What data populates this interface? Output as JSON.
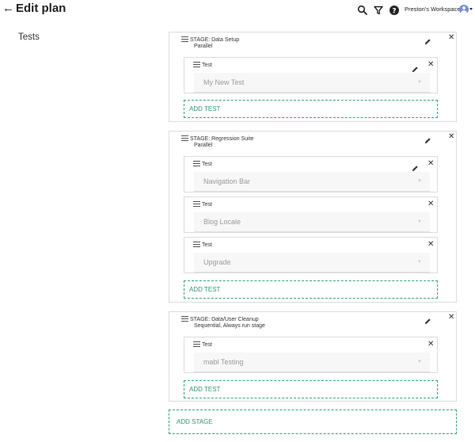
{
  "header": {
    "back_icon": "arrow-left-icon",
    "title": "Edit plan",
    "icons": [
      "search-icon",
      "filter-icon",
      "help-icon"
    ],
    "workspace_label": "Preston's Workspace",
    "avatar_icon": "user-avatar-icon"
  },
  "main": {
    "section_title": "Tests",
    "stages": [
      {
        "title": "STAGE: Data Setup",
        "subtitle": "Parallel",
        "tests": [
          {
            "label": "Test",
            "value": "My New Test",
            "editable": true
          }
        ],
        "add_test_label": "ADD TEST"
      },
      {
        "title": "STAGE: Regression Suite",
        "subtitle": "Parallel",
        "tests": [
          {
            "label": "Test",
            "value": "Navigation Bar",
            "editable": true
          },
          {
            "label": "Test",
            "value": "Blog Locale",
            "editable": false
          },
          {
            "label": "Test",
            "value": "Upgrade",
            "editable": false
          }
        ],
        "add_test_label": "ADD TEST"
      },
      {
        "title": "STAGE: Data/User Cleanup",
        "subtitle": "Sequential, Always run stage",
        "tests": [
          {
            "label": "Test",
            "value": "mabl Testing",
            "editable": false
          }
        ],
        "add_test_label": "ADD TEST"
      }
    ],
    "add_stage_label": "ADD STAGE"
  },
  "colors": {
    "accent_green": "#2e9a70",
    "border": "#dcdcdc",
    "avatar_blue": "#6f8fd6"
  }
}
